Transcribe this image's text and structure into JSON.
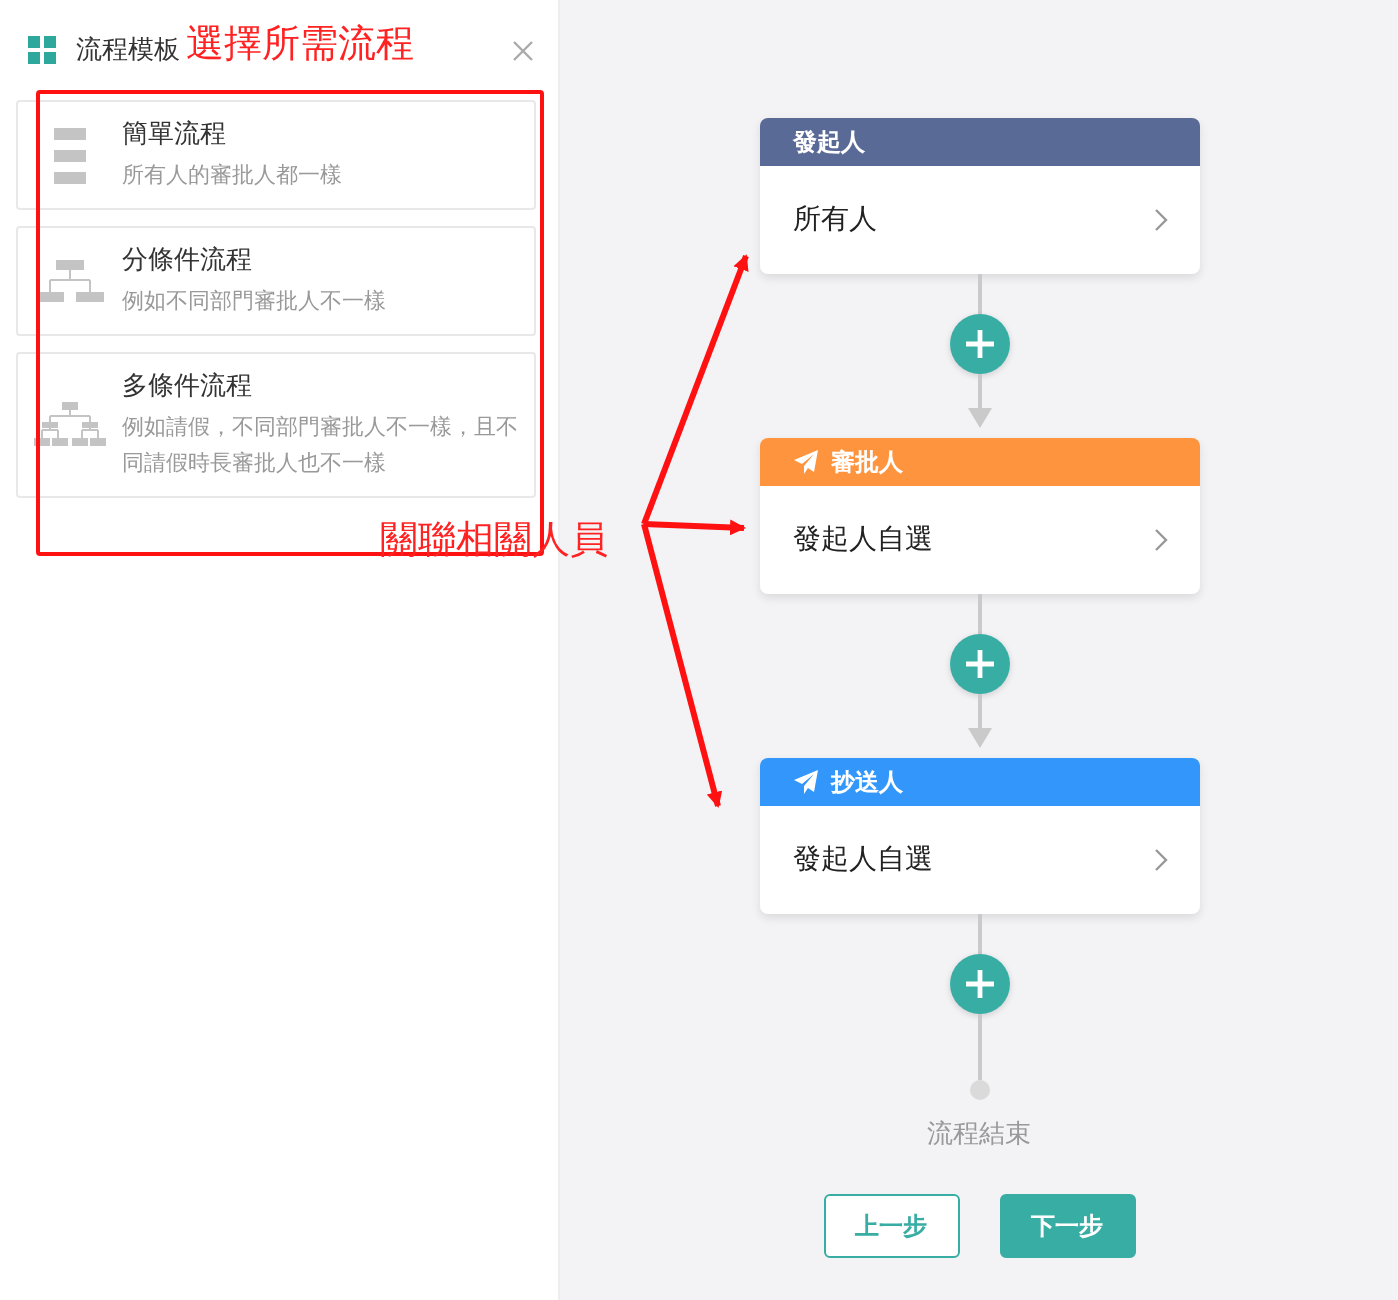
{
  "panel": {
    "title": "流程模板"
  },
  "templates": [
    {
      "kind": "simple",
      "title": "簡單流程",
      "description": "所有人的審批人都一樣"
    },
    {
      "kind": "branch",
      "title": "分條件流程",
      "description": "例如不同部門審批人不一樣"
    },
    {
      "kind": "multi",
      "title": "多條件流程",
      "description": "例如請假，不同部門審批人不一樣，且不同請假時長審批人也不一樣"
    }
  ],
  "annotations": {
    "heading": "選擇所需流程",
    "callout": "關聯相關人員"
  },
  "flow": {
    "nodes": [
      {
        "kind": "initiator",
        "header": "發起人",
        "value": "所有人",
        "color": "#5a6a96"
      },
      {
        "kind": "approver",
        "header": "審批人",
        "value": "發起人自選",
        "color": "#ff943e"
      },
      {
        "kind": "cc",
        "header": "抄送人",
        "value": "發起人自選",
        "color": "#3296fa"
      }
    ],
    "end_label": "流程結束"
  },
  "buttons": [
    {
      "kind": "secondary",
      "label": "上一步"
    },
    {
      "kind": "primary",
      "label": "下一步"
    }
  ]
}
